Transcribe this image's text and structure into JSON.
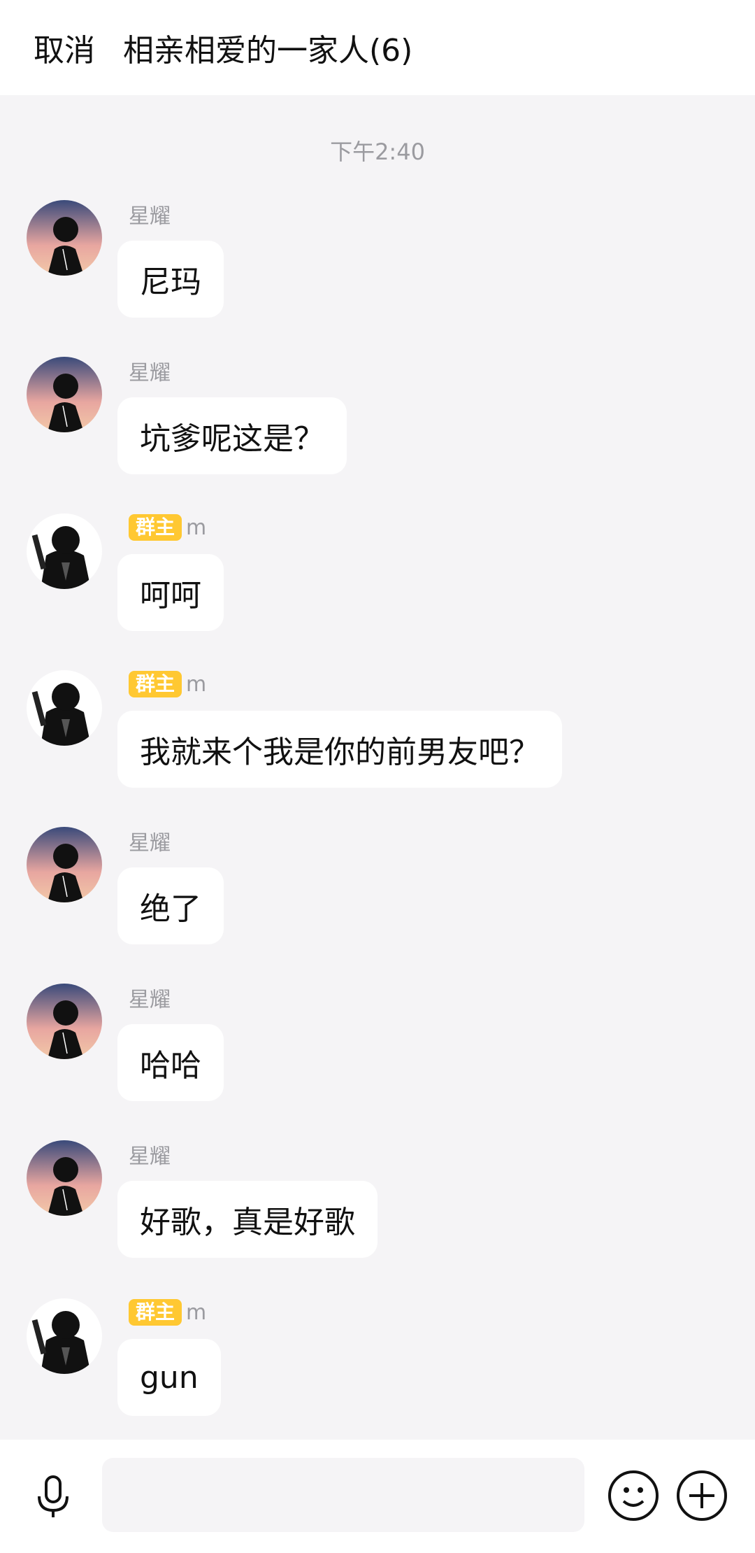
{
  "header": {
    "cancel_label": "取消",
    "title": "相亲相爱的一家人(6)"
  },
  "chat": {
    "timestamp": "下午2:40",
    "messages": [
      {
        "sender": "星耀",
        "badge": "",
        "avatar": "avatar-xingyao",
        "text": "尼玛"
      },
      {
        "sender": "星耀",
        "badge": "",
        "avatar": "avatar-xingyao",
        "text": "坑爹呢这是？"
      },
      {
        "sender": "m",
        "badge": "群主",
        "avatar": "avatar-m",
        "text": "呵呵"
      },
      {
        "sender": "m",
        "badge": "群主",
        "avatar": "avatar-m",
        "text": "我就来个我是你的前男友吧？"
      },
      {
        "sender": "星耀",
        "badge": "",
        "avatar": "avatar-xingyao",
        "text": "绝了"
      },
      {
        "sender": "星耀",
        "badge": "",
        "avatar": "avatar-xingyao",
        "text": "哈哈"
      },
      {
        "sender": "星耀",
        "badge": "",
        "avatar": "avatar-xingyao",
        "text": "好歌，真是好歌"
      },
      {
        "sender": "m",
        "badge": "群主",
        "avatar": "avatar-m",
        "text": "gun"
      }
    ]
  },
  "inputbar": {
    "placeholder": "",
    "icons": [
      "microphone-icon",
      "emoji-icon",
      "plus-icon"
    ]
  },
  "colors": {
    "background": "#f5f4f6",
    "bubble": "#ffffff",
    "badge": "#ffc832",
    "muted_text": "#9b9ba0"
  }
}
